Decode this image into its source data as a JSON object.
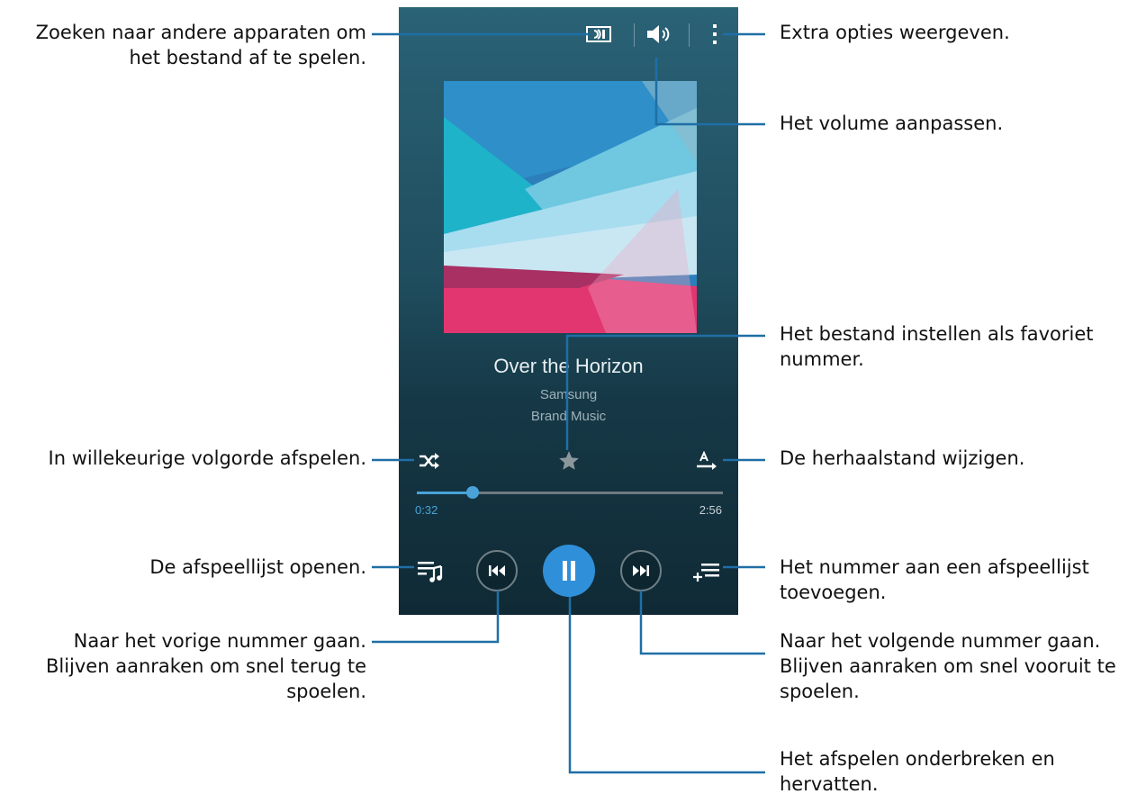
{
  "player": {
    "song_title": "Over the Horizon",
    "artist": "Samsung",
    "album": "Brand Music",
    "current_time": "0:32",
    "total_time": "2:56",
    "progress": 0.182,
    "accent_color": "#2f8fd8"
  },
  "callouts": {
    "search_devices": "Zoeken naar andere apparaten om\nhet bestand af te spelen.",
    "extra_options": "Extra opties weergeven.",
    "volume": "Het volume aanpassen.",
    "favorite": "Het bestand instellen als favoriet\nnummer.",
    "shuffle": "In willekeurige volgorde afspelen.",
    "repeat": "De herhaalstand wijzigen.",
    "playlist_open": "De afspeellijst openen.",
    "add_to_playlist": "Het nummer aan een afspeellijst\ntoevoegen.",
    "previous": "Naar het vorige nummer gaan.\nBlijven aanraken om snel terug te\nspoelen.",
    "next": "Naar het volgende nummer gaan.\nBlijven aanraken om snel vooruit te\nspoelen.",
    "pause": "Het afspelen onderbreken en\nhervatten."
  },
  "icons": {
    "device_search": "screen-mirroring-icon",
    "volume": "speaker-icon",
    "more": "more-vert-icon",
    "favorite": "star-icon",
    "shuffle": "shuffle-icon",
    "repeat": "repeat-all-icon",
    "playlist": "playlist-icon",
    "previous": "skip-previous-icon",
    "pause": "pause-icon",
    "next": "skip-next-icon",
    "add_playlist": "playlist-add-icon"
  }
}
